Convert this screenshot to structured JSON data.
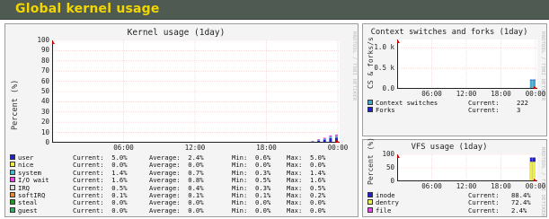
{
  "header": {
    "title": "Global kernel usage"
  },
  "kernel_panel": {
    "title": "Kernel usage  (1day)",
    "y_label": "Percent (%)",
    "watermark": "RRDTOOL / TOBI OETIKER",
    "legend": [
      {
        "name": "user",
        "color": "#2222cc",
        "current": "Current:  5.0%",
        "average": "Average:  2.4%",
        "min": "Min:  0.6%",
        "max": "Max:  5.0%"
      },
      {
        "name": "nice",
        "color": "#eeee44",
        "current": "Current:  0.0%",
        "average": "Average:  0.0%",
        "min": "Min:  0.0%",
        "max": "Max:  0.0%"
      },
      {
        "name": "system",
        "color": "#44bbcc",
        "current": "Current:  1.4%",
        "average": "Average:  0.7%",
        "min": "Min:  0.3%",
        "max": "Max:  1.4%"
      },
      {
        "name": "I/O wait",
        "color": "#ee44ee",
        "current": "Current:  1.6%",
        "average": "Average:  0.8%",
        "min": "Min:  0.5%",
        "max": "Max:  1.6%"
      },
      {
        "name": "IRQ",
        "color": "#dddddd",
        "current": "Current:  0.5%",
        "average": "Average:  0.4%",
        "min": "Min:  0.3%",
        "max": "Max:  0.5%"
      },
      {
        "name": "softIRQ",
        "color": "#ee8833",
        "current": "Current:  0.1%",
        "average": "Average:  0.1%",
        "min": "Min:  0.1%",
        "max": "Max:  0.2%"
      },
      {
        "name": "steal",
        "color": "#229922",
        "current": "Current:  0.0%",
        "average": "Average:  0.0%",
        "min": "Min:  0.0%",
        "max": "Max:  0.0%"
      },
      {
        "name": "guest",
        "color": "#33aa66",
        "current": "Current:  0.0%",
        "average": "Average:  0.0%",
        "min": "Min:  0.0%",
        "max": "Max:  0.0%"
      }
    ]
  },
  "ctx_panel": {
    "title": "Context switches and forks  (1day)",
    "y_label": "CS & forks/s",
    "watermark": "RRDTOOL / TOBI OETIKER",
    "legend": [
      {
        "name": "Context switches",
        "color": "#44aacc",
        "label": "Current:",
        "value": "222"
      },
      {
        "name": "Forks",
        "color": "#2222cc",
        "label": "Current:",
        "value": "3"
      }
    ]
  },
  "vfs_panel": {
    "title": "VFS usage  (1day)",
    "y_label": "Percent (%)",
    "watermark": "RRDTOOL / TOBI OETIKER",
    "legend": [
      {
        "name": "inode",
        "color": "#2222cc",
        "label": "Current:",
        "value": "88.4%"
      },
      {
        "name": "dentry",
        "color": "#eeee44",
        "label": "Current:",
        "value": "72.4%"
      },
      {
        "name": "file",
        "color": "#ee44ee",
        "label": "Current:",
        "value": "2.4%"
      }
    ]
  },
  "chart_data": [
    {
      "type": "area",
      "title": "Kernel usage  (1day)",
      "ylabel": "Percent (%)",
      "xlabel": "",
      "ylim": [
        0,
        100
      ],
      "y_ticks": [
        "0",
        "10",
        "20",
        "30",
        "40",
        "50",
        "60",
        "70",
        "80",
        "90",
        "100"
      ],
      "x_ticks": [
        "06:00",
        "12:00",
        "18:00",
        "00:00"
      ],
      "x": [
        "22:00",
        "22:30",
        "23:00",
        "23:30",
        "00:00"
      ],
      "series": [
        {
          "name": "user",
          "values": [
            1.0,
            2.0,
            3.0,
            4.5,
            5.0
          ]
        },
        {
          "name": "system",
          "values": [
            0.3,
            0.6,
            0.9,
            1.2,
            1.4
          ]
        },
        {
          "name": "I/O wait",
          "values": [
            0.5,
            0.8,
            1.0,
            1.4,
            1.6
          ]
        }
      ]
    },
    {
      "type": "area",
      "title": "Context switches and forks  (1day)",
      "ylabel": "CS & forks/s",
      "xlabel": "",
      "ylim": [
        0,
        1200
      ],
      "y_ticks": [
        "0.0",
        "0.5 k",
        "1.0 k"
      ],
      "x_ticks": [
        "06:00",
        "12:00",
        "18:00",
        "00:00"
      ],
      "x": [
        "23:00",
        "23:30",
        "00:00"
      ],
      "series": [
        {
          "name": "Context switches",
          "values": [
            0,
            222,
            222
          ]
        },
        {
          "name": "Forks",
          "values": [
            0,
            3,
            3
          ]
        }
      ]
    },
    {
      "type": "area",
      "title": "VFS usage  (1day)",
      "ylabel": "Percent (%)",
      "xlabel": "",
      "ylim": [
        0,
        100
      ],
      "y_ticks": [
        "0",
        "50",
        "100"
      ],
      "x_ticks": [
        "06:00",
        "12:00",
        "18:00",
        "00:00"
      ],
      "x": [
        "23:30",
        "00:00"
      ],
      "series": [
        {
          "name": "inode",
          "values": [
            88.4,
            88.4
          ]
        },
        {
          "name": "dentry",
          "values": [
            72.4,
            72.4
          ]
        },
        {
          "name": "file",
          "values": [
            2.4,
            2.4
          ]
        }
      ]
    }
  ]
}
